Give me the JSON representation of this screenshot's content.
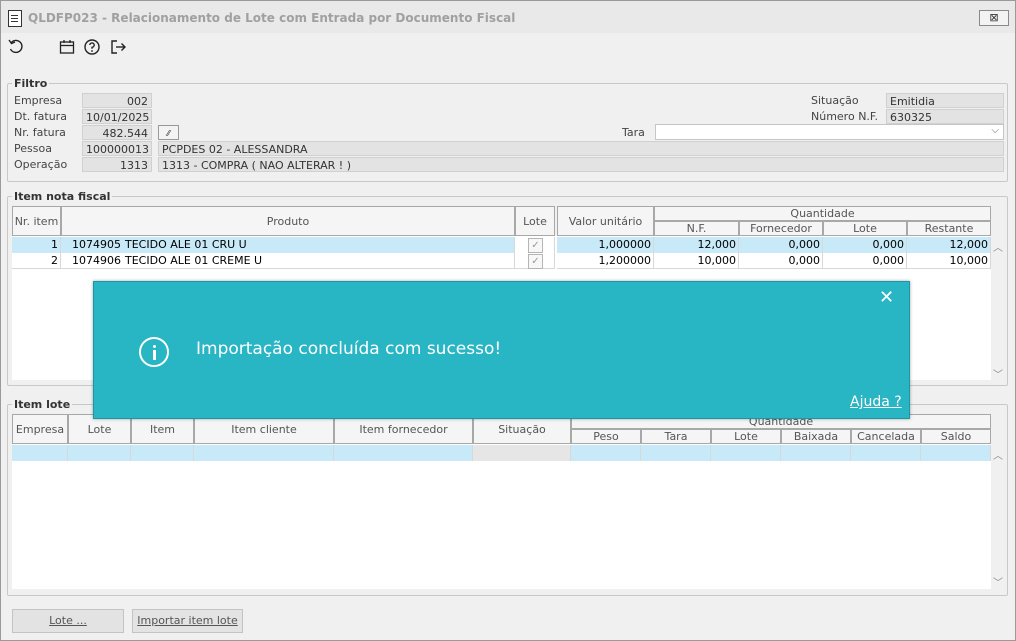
{
  "window": {
    "title": "QLDFP023 - Relacionamento de Lote com Entrada por Documento Fiscal",
    "close_label": "⊠"
  },
  "toolbar": {
    "icons": [
      "refresh-icon",
      "calendar-icon",
      "help-icon",
      "exit-icon"
    ]
  },
  "filtro": {
    "legend": "Filtro",
    "empresa_label": "Empresa",
    "empresa_value": "002",
    "dt_fatura_label": "Dt. fatura",
    "dt_fatura_value": "10/01/2025",
    "nr_fatura_label": "Nr. fatura",
    "nr_fatura_value": "482.544",
    "pessoa_label": "Pessoa",
    "pessoa_code": "100000013",
    "pessoa_name": "PCPDES 02 - ALESSANDRA",
    "operacao_label": "Operação",
    "operacao_code": "1313",
    "operacao_desc": "1313 - COMPRA ( NAO ALTERAR ! )",
    "situacao_label": "Situação",
    "situacao_value": "Emitidia",
    "numero_nf_label": "Número N.F.",
    "numero_nf_value": "630325",
    "tara_label": "Tara",
    "tara_value": ""
  },
  "item_nota_fiscal": {
    "legend": "Item nota fiscal",
    "headers": {
      "nr_item": "Nr. item",
      "produto": "Produto",
      "lote": "Lote",
      "valor_unitario": "Valor unitário",
      "quantidade": "Quantidade",
      "nf": "N.F.",
      "fornecedor": "Fornecedor",
      "lote_qtd": "Lote",
      "restante": "Restante"
    },
    "rows": [
      {
        "nr": "1",
        "produto_code": "1074905",
        "produto_desc": "TECIDO ALE 01 CRU U",
        "lote_checked": true,
        "valor": "1,000000",
        "nf": "12,000",
        "fornecedor": "0,000",
        "lote": "0,000",
        "restante": "12,000"
      },
      {
        "nr": "2",
        "produto_code": "1074906",
        "produto_desc": "TECIDO ALE 01 CREME U",
        "lote_checked": true,
        "valor": "1,200000",
        "nf": "10,000",
        "fornecedor": "0,000",
        "lote": "0,000",
        "restante": "10,000"
      }
    ]
  },
  "item_lote": {
    "legend": "Item lote",
    "headers": {
      "empresa": "Empresa",
      "lote": "Lote",
      "item": "Item",
      "item_cliente": "Item cliente",
      "item_fornecedor": "Item fornecedor",
      "situacao": "Situação",
      "quantidade": "Quantidade",
      "peso": "Peso",
      "tara": "Tara",
      "lote_qtd": "Lote",
      "baixada": "Baixada",
      "cancelada": "Cancelada",
      "saldo": "Saldo"
    }
  },
  "buttons": {
    "lote": "Lote ...",
    "importar": "Importar item lote"
  },
  "toast": {
    "message": "Importação concluída com sucesso!",
    "help_link": "Ajuda ?",
    "close_label": "✕",
    "bg_color": "#28b5c4"
  },
  "colors": {
    "selected_row": "#c8e9f7"
  }
}
